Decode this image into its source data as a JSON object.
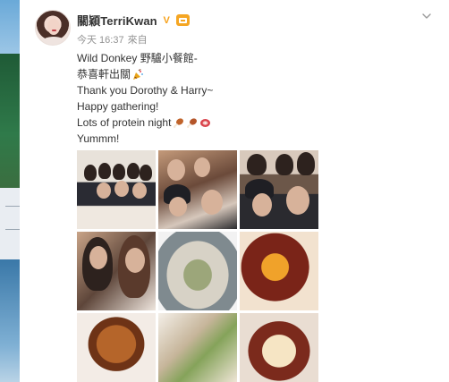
{
  "post": {
    "author": "關穎TerriKwan",
    "vip_mark": "V",
    "time": "今天 16:37",
    "source": "來自",
    "lines": [
      "Wild Donkey 野驢小餐館-",
      "恭喜軒出關",
      "Thank you Dorothy & Harry~",
      "Happy gathering!",
      "Lots of protein night",
      "Yummm!"
    ]
  },
  "icons": {
    "vip": "verified-v-icon",
    "member": "member-crown-icon",
    "menu": "chevron-down-icon",
    "emoji_party": "party-popper-icon",
    "emoji_drumstick": "drumstick-icon",
    "emoji_meat": "meat-icon"
  },
  "colors": {
    "accent": "#f7a11a",
    "meta_text": "#939393",
    "body_text": "#333333"
  },
  "photos": [
    {
      "id": "photo-1",
      "subject": "group-dinner"
    },
    {
      "id": "photo-2",
      "subject": "group-selfie"
    },
    {
      "id": "photo-3",
      "subject": "group-selfie-hats"
    },
    {
      "id": "photo-4",
      "subject": "two-women"
    },
    {
      "id": "photo-5",
      "subject": "oyster"
    },
    {
      "id": "photo-6",
      "subject": "sliced-meat"
    },
    {
      "id": "photo-7",
      "subject": "roast-meat"
    },
    {
      "id": "photo-8",
      "subject": "appetizers"
    },
    {
      "id": "photo-9",
      "subject": "dessert"
    }
  ]
}
